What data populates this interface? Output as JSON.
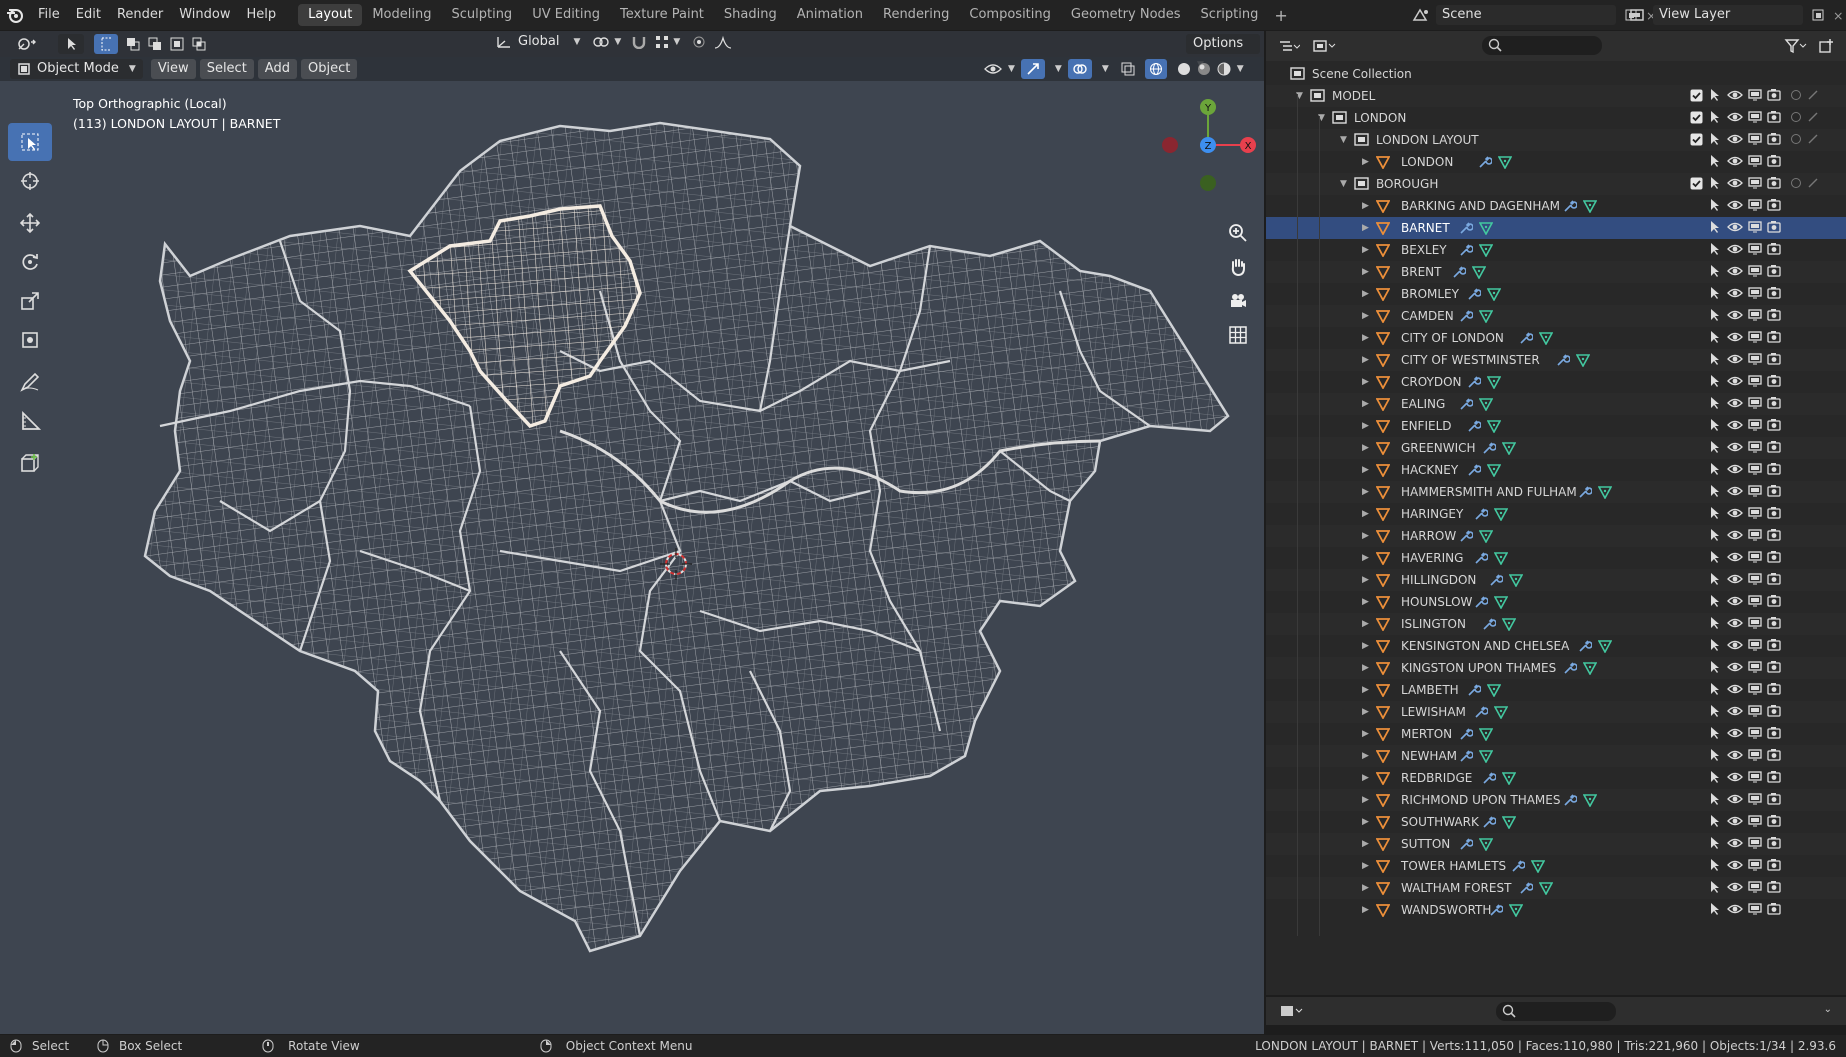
{
  "topbar": {
    "menus": [
      "File",
      "Edit",
      "Render",
      "Window",
      "Help"
    ],
    "tabs": [
      "Layout",
      "Modeling",
      "Sculpting",
      "UV Editing",
      "Texture Paint",
      "Shading",
      "Animation",
      "Rendering",
      "Compositing",
      "Geometry Nodes",
      "Scripting"
    ],
    "active_tab": "Layout",
    "add_tab": "+",
    "scene_label": "Scene",
    "view_layer_label": "View Layer"
  },
  "viewport": {
    "transform_orientation": "Global",
    "options_label": "Options",
    "mode": "Object Mode",
    "menus": [
      "View",
      "Select",
      "Add",
      "Object"
    ],
    "view_name": "Top Orthographic (Local)",
    "context": "(113) LONDON LAYOUT | BARNET",
    "gizmo_axes": {
      "y": "Y",
      "z": "Z",
      "x": "X"
    },
    "tools": [
      "select-box",
      "cursor",
      "move",
      "rotate",
      "scale",
      "transform",
      "annotate",
      "measure",
      "add-cube"
    ],
    "nav_buttons": [
      "zoom",
      "pan",
      "camera",
      "grid"
    ],
    "colors": {
      "background": "#3e4550",
      "wire": "#c8c8c8",
      "selected": "#f2e6da",
      "active_tool": "#4772b3",
      "x_axis": "#e8404d",
      "y_axis": "#6ba53a",
      "z_axis": "#3d8ff0"
    }
  },
  "outliner": {
    "header_title": "Scene Collection",
    "collections": [
      {
        "name": "MODEL",
        "level": 0
      },
      {
        "name": "LONDON",
        "level": 1
      },
      {
        "name": "LONDON LAYOUT",
        "level": 2
      }
    ],
    "london_object": "LONDON",
    "borough_collection": "BOROUGH",
    "selected": "BARNET",
    "boroughs": [
      "BARKING AND DAGENHAM",
      "BARNET",
      "BEXLEY",
      "BRENT",
      "BROMLEY",
      "CAMDEN",
      "CITY OF LONDON",
      "CITY OF WESTMINSTER",
      "CROYDON",
      "EALING",
      "ENFIELD",
      "GREENWICH",
      "HACKNEY",
      "HAMMERSMITH AND FULHAM",
      "HARINGEY",
      "HARROW",
      "HAVERING",
      "HILLINGDON",
      "HOUNSLOW",
      "ISLINGTON",
      "KENSINGTON AND CHELSEA",
      "KINGSTON UPON THAMES",
      "LAMBETH",
      "LEWISHAM",
      "MERTON",
      "NEWHAM",
      "REDBRIDGE",
      "RICHMOND UPON THAMES",
      "SOUTHWARK",
      "SUTTON",
      "TOWER HAMLETS",
      "WALTHAM FOREST",
      "WANDSWORTH"
    ]
  },
  "status": {
    "items": [
      {
        "icon": "mouse-left-icon",
        "label": "Select"
      },
      {
        "icon": "mouse-left-drag-icon",
        "label": "Box Select"
      },
      {
        "icon": "mouse-middle-icon",
        "label": "Rotate View"
      },
      {
        "icon": "mouse-right-icon",
        "label": "Object Context Menu"
      }
    ],
    "stats": "LONDON LAYOUT | BARNET | Verts:111,050 | Faces:110,980 | Tris:221,960 | Objects:1/34 | 2.93.6"
  }
}
